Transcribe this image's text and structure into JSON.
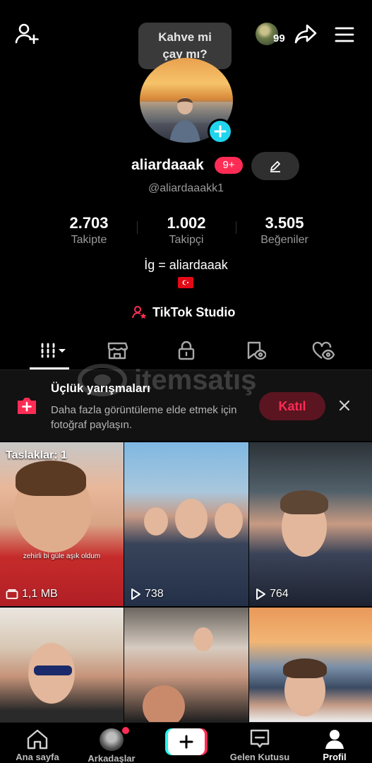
{
  "header": {
    "bubble_text_line1": "Kahve mi",
    "bubble_text_line2": "çay mı?",
    "visitor_count": "99"
  },
  "profile": {
    "username": "aliardaaak",
    "notification_badge": "9+",
    "handle": "@aliardaaakk1",
    "bio": "İg = aliardaaak"
  },
  "stats": [
    {
      "value": "2.703",
      "label": "Takipte"
    },
    {
      "value": "1.002",
      "label": "Takipçi"
    },
    {
      "value": "3.505",
      "label": "Beğeniler"
    }
  ],
  "studio": {
    "label": "TikTok Studio"
  },
  "tabs": [
    "videos",
    "shop",
    "private",
    "saved",
    "liked"
  ],
  "watermark": {
    "text": "itemsatış"
  },
  "banner": {
    "title": "Üçlük yarışmaları",
    "description": "Daha fazla görüntüleme elde etmek için fotoğraf paylaşın.",
    "join_label": "Katıl"
  },
  "grid": [
    {
      "overlay": "Taslaklar: 1",
      "caption": "zehirli bi güle aşık oldum",
      "meta": "1,1 MB",
      "meta_icon": "draft-icon"
    },
    {
      "meta": "738",
      "meta_icon": "play-icon"
    },
    {
      "meta": "764",
      "meta_icon": "play-icon"
    },
    {},
    {},
    {}
  ],
  "nav": {
    "home": "Ana sayfa",
    "friends": "Arkadaşlar",
    "inbox": "Gelen Kutusu",
    "profile": "Profil"
  },
  "colors": {
    "accent": "#fe2c55",
    "cyan": "#20d5ec",
    "background": "#000000"
  }
}
